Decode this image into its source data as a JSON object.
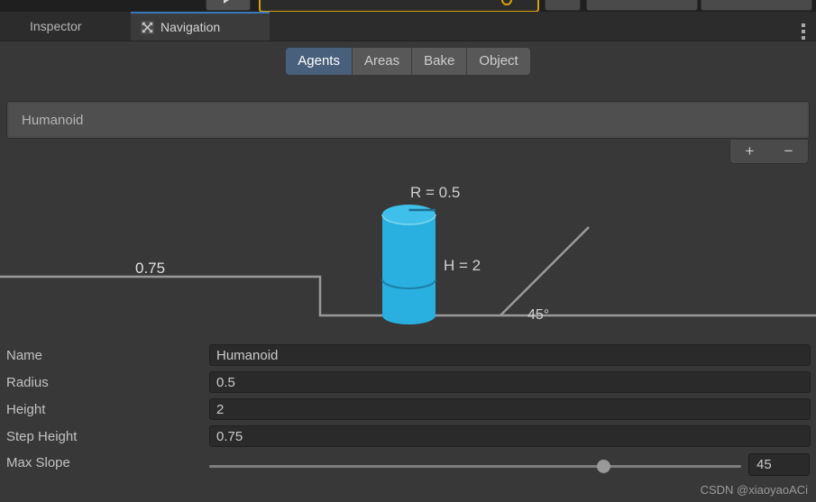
{
  "window": {
    "title": "Navigation",
    "background_color": "#383838"
  },
  "top_toolbar": {
    "play_button": "play-button",
    "search_field_value": "",
    "search_highlight_color": "#d6a10d",
    "small_button": "",
    "layers_dropdown": "",
    "layout_dropdown": ""
  },
  "tabs": {
    "items": [
      {
        "label": "Inspector",
        "icon": "info-icon",
        "active": false
      },
      {
        "label": "Navigation",
        "icon": "move-arrows-icon",
        "active": true
      }
    ],
    "active_indicator_color": "#3a79bb",
    "menu_icon": "kebab-menu-icon"
  },
  "subtoolbar": {
    "segments": [
      {
        "label": "Agents",
        "active": true
      },
      {
        "label": "Areas",
        "active": false
      },
      {
        "label": "Bake",
        "active": false
      },
      {
        "label": "Object",
        "active": false
      }
    ],
    "active_color": "#49607d"
  },
  "agent_list": {
    "items": [
      {
        "label": "Humanoid",
        "selected": true
      }
    ],
    "add_button": "+",
    "remove_button": "−"
  },
  "diagram": {
    "radius_label": "R = 0.5",
    "height_label": "H = 2",
    "step_label": "0.75",
    "slope_label": "45°",
    "agent_color": "#29b0e0",
    "agent_top_color": "#3fc0ea",
    "line_color": "#9a9a9a"
  },
  "properties": {
    "rows": [
      {
        "label": "Name",
        "value": "Humanoid"
      },
      {
        "label": "Radius",
        "value": "0.5"
      },
      {
        "label": "Height",
        "value": "2"
      },
      {
        "label": "Step Height",
        "value": "0.75"
      }
    ],
    "slider": {
      "label": "Max Slope",
      "value": "45",
      "min": 0,
      "max": 60,
      "knob_percent": 74
    }
  },
  "watermark": {
    "text": "CSDN @xiaoyaoACi"
  }
}
